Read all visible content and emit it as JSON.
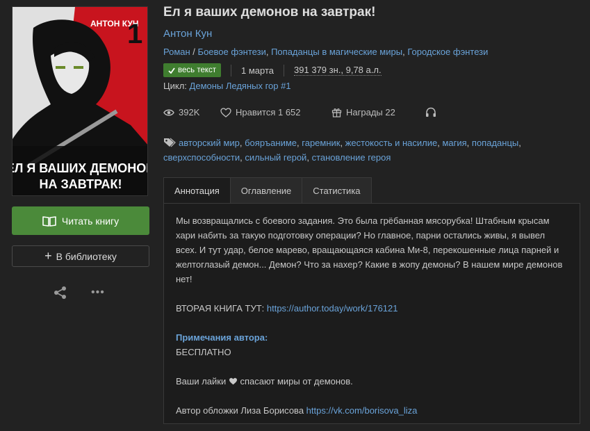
{
  "cover": {
    "author": "АНТОН КУН",
    "number": "1",
    "title_line1": "ЕЛ Я ВАШИХ ДЕМОНОВ",
    "title_line2": "НА ЗАВТРАК!"
  },
  "actions": {
    "read_label": "Читать книгу",
    "library_label": "В библиотеку",
    "more_label": "•••"
  },
  "book": {
    "title": "Ел я ваших демонов на завтрак!",
    "author": "Антон Кун",
    "genres": [
      "Роман",
      "Боевое фэнтези",
      "Попаданцы в магические миры",
      "Городское фэнтези"
    ],
    "genre_sep1": " / ",
    "genre_sep2": ", ",
    "genre_sep3": ", ",
    "status_badge": "весь текст",
    "date": "1 марта",
    "size": "391 379 зн., 9,78 а.л.",
    "cycle_label": "Цикл: ",
    "cycle_value": "Демоны Ледяных гор #1"
  },
  "stats": {
    "views": "392K",
    "likes_label": "Нравится 1 652",
    "awards_label": "Награды 22"
  },
  "tags": [
    "авторский мир",
    "бояръаниме",
    "гаремник",
    "жестокость и насилие",
    "магия",
    "попаданцы",
    "сверхспособности",
    "сильный герой",
    "становление героя"
  ],
  "tabs": [
    "Аннотация",
    "Оглавление",
    "Статистика"
  ],
  "annotation": {
    "p1": "Мы возвращались с боевого задания. Это была грёбанная мясорубка! Штабным крысам хари набить за такую подготовку операции? Но главное, парни остались живы, я вывел всех. И тут удар, белое марево, вращающаяся кабина Ми-8, перекошенные лица парней и желтоглазый демон... Демон? Что за нахер? Какие в жопу демоны? В нашем мире демонов нет!",
    "second_book_label": "ВТОРАЯ КНИГА ТУТ: ",
    "second_book_link": "https://author.today/work/176121",
    "notes_head": "Примечания автора:",
    "notes_free": "БЕСПЛАТНО",
    "likes_pre": "Ваши лайки ",
    "likes_post": " спасают миры от демонов.",
    "cover_credit": "Автор обложки Лиза Борисова ",
    "cover_link": "https://vk.com/borisova_liza"
  },
  "colors": {
    "accent": "#6aa3d9",
    "green": "#4b8a3a",
    "cover_red": "#c8141e"
  }
}
